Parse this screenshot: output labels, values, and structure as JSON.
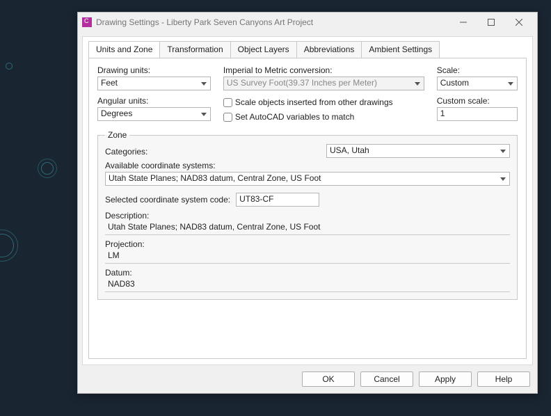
{
  "window": {
    "title": "Drawing Settings - Liberty Park Seven Canyons Art Project"
  },
  "tabs": {
    "units_zone": "Units and Zone",
    "transformation": "Transformation",
    "object_layers": "Object Layers",
    "abbreviations": "Abbreviations",
    "ambient_settings": "Ambient Settings"
  },
  "units": {
    "drawing_units_label": "Drawing units:",
    "drawing_units_value": "Feet",
    "angular_units_label": "Angular units:",
    "angular_units_value": "Degrees",
    "imperial_label": "Imperial to Metric conversion:",
    "imperial_value": "US Survey Foot(39.37 Inches per Meter)",
    "scale_objects_label": "Scale objects inserted from other drawings",
    "set_autocad_label": "Set AutoCAD variables to match",
    "scale_label": "Scale:",
    "scale_value": "Custom",
    "custom_scale_label": "Custom scale:",
    "custom_scale_value": "1"
  },
  "zone": {
    "legend": "Zone",
    "categories_label": "Categories:",
    "categories_value": "USA, Utah",
    "available_label": "Available coordinate systems:",
    "available_value": "Utah State Planes; NAD83 datum, Central Zone, US Foot",
    "selected_label": "Selected coordinate system code:",
    "selected_value": "UT83-CF",
    "description_label": "Description:",
    "description_value": "Utah State Planes; NAD83 datum, Central Zone, US Foot",
    "projection_label": "Projection:",
    "projection_value": "LM",
    "datum_label": "Datum:",
    "datum_value": "NAD83"
  },
  "buttons": {
    "ok": "OK",
    "cancel": "Cancel",
    "apply": "Apply",
    "help": "Help"
  }
}
